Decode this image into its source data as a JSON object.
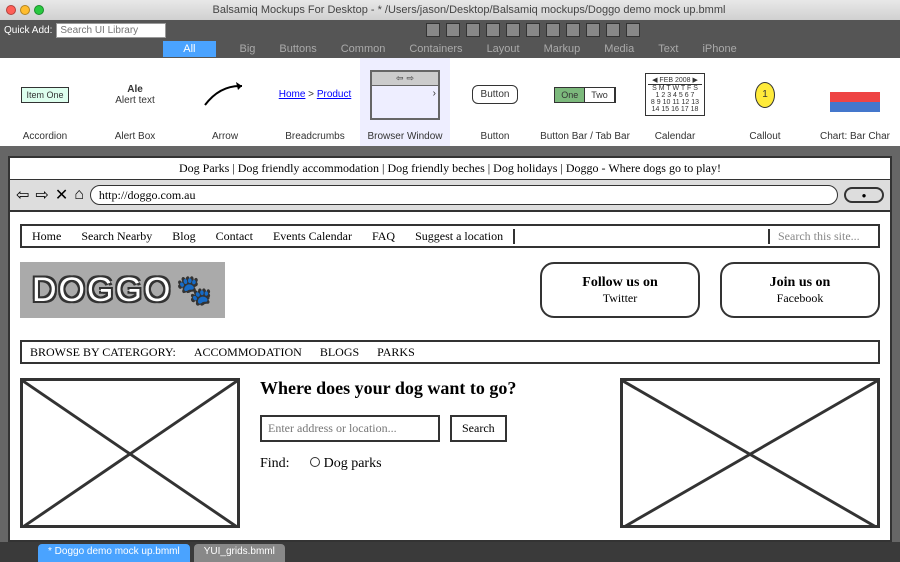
{
  "window": {
    "title": "Balsamiq Mockups For Desktop - * /Users/jason/Desktop/Balsamiq mockups/Doggo demo mock up.bmml"
  },
  "quickadd": {
    "label": "Quick Add:",
    "placeholder": "Search UI Library"
  },
  "categories": [
    "All",
    "Big",
    "Buttons",
    "Common",
    "Containers",
    "Layout",
    "Markup",
    "Media",
    "Text",
    "iPhone"
  ],
  "categories_active": 0,
  "palette": {
    "accordion": {
      "item": "Item One",
      "label": "Accordion"
    },
    "alert": {
      "title": "Ale",
      "text": "Alert text",
      "label": "Alert Box"
    },
    "arrow": {
      "label": "Arrow"
    },
    "breadcrumbs": {
      "a": "Home",
      "b": "Product",
      "label": "Breadcrumbs"
    },
    "browser": {
      "label": "Browser Window"
    },
    "button": {
      "text": "Button",
      "label": "Button"
    },
    "bbar": {
      "a": "One",
      "b": "Two",
      "label": "Button Bar / Tab Bar"
    },
    "calendar": {
      "month": "FEB 2008",
      "label": "Calendar"
    },
    "callout": {
      "n": "1",
      "label": "Callout"
    },
    "chart": {
      "label": "Chart: Bar Char"
    }
  },
  "mockup": {
    "tagline": "Dog Parks | Dog friendly accommodation | Dog friendly beches | Dog holidays | Doggo - Where dogs go to play!",
    "url": "http://doggo.com.au",
    "nav": [
      "Home",
      "Search Nearby",
      "Blog",
      "Contact",
      "Events Calendar",
      "FAQ",
      "Suggest a location"
    ],
    "search_placeholder": "Search this site...",
    "logo": "DOGGO",
    "follow": {
      "t": "Follow us on",
      "s": "Twitter"
    },
    "join": {
      "t": "Join us on",
      "s": "Facebook"
    },
    "cat_label": "BROWSE BY CATERGORY:",
    "cats": [
      "ACCOMMODATION",
      "BLOGS",
      "PARKS"
    ],
    "question": "Where does your dog want to go?",
    "addr_placeholder": "Enter address or location...",
    "search_btn": "Search",
    "find_label": "Find:",
    "find_opt": "Dog parks"
  },
  "tabs": [
    {
      "label": "* Doggo demo mock up.bmml",
      "active": true
    },
    {
      "label": "YUI_grids.bmml",
      "active": false
    }
  ]
}
